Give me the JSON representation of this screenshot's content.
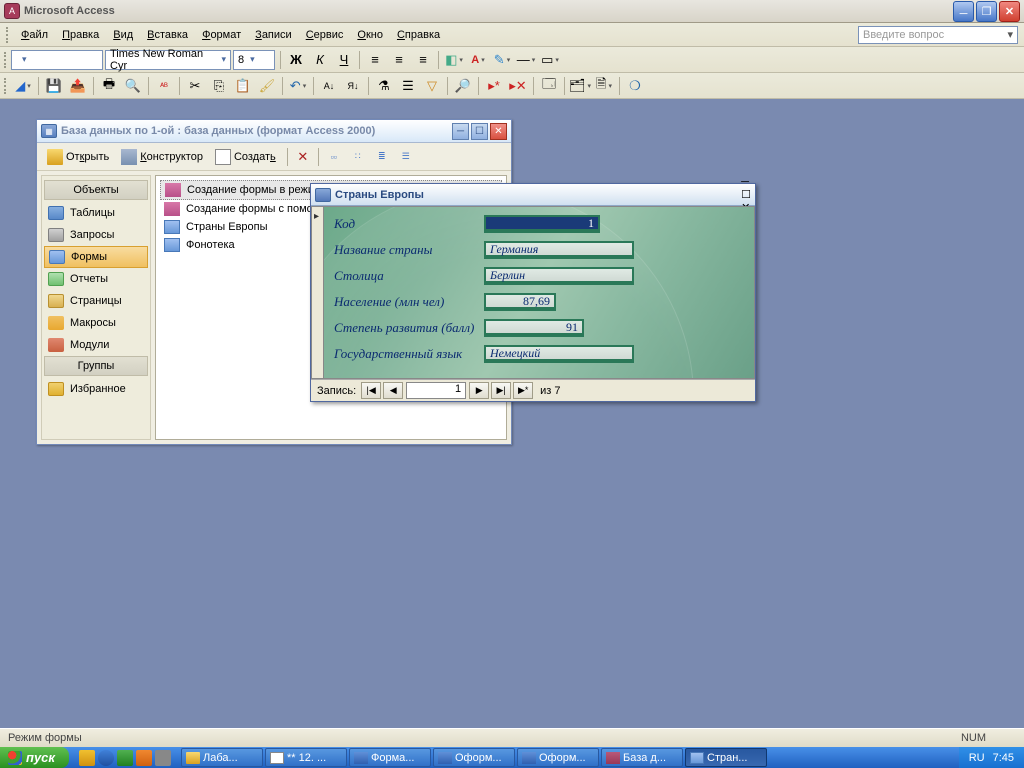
{
  "app": {
    "title": "Microsoft Access"
  },
  "menu": {
    "items": [
      "Файл",
      "Правка",
      "Вид",
      "Вставка",
      "Формат",
      "Записи",
      "Сервис",
      "Окно",
      "Справка"
    ],
    "underlines": [
      "Ф",
      "П",
      "В",
      "В",
      "Ф",
      "З",
      "С",
      "О",
      "С"
    ],
    "question_placeholder": "Введите вопрос"
  },
  "format_toolbar": {
    "font": "Times New Roman Cyr",
    "size": "8"
  },
  "dbwin": {
    "title": "База данных по 1-ой : база данных (формат Access 2000)",
    "toolbar": {
      "open": "Открыть",
      "design": "Конструктор",
      "create": "Создать"
    },
    "sidebar": {
      "header1": "Объекты",
      "items": [
        "Таблицы",
        "Запросы",
        "Формы",
        "Отчеты",
        "Страницы",
        "Макросы",
        "Модули"
      ],
      "header2": "Группы",
      "fav": "Избранное"
    },
    "list": {
      "items": [
        "Создание формы в режиме конструктора",
        "Создание формы с помощью мастера",
        "Страны Европы",
        "Фонотека"
      ]
    }
  },
  "formwin": {
    "title": "Страны Европы",
    "fields": {
      "f1": {
        "label": "Код",
        "value": "1"
      },
      "f2": {
        "label": "Название страны",
        "value": "Германия"
      },
      "f3": {
        "label": "Столица",
        "value": "Берлин"
      },
      "f4": {
        "label": "Население (млн чел)",
        "value": "87,69"
      },
      "f5": {
        "label": "Степень развития (балл)",
        "value": "91"
      },
      "f6": {
        "label": "Государственный язык",
        "value": "Немецкий"
      }
    },
    "recnav": {
      "label": "Запись:",
      "current": "1",
      "total": "из  7"
    }
  },
  "statusbar": {
    "left": "Режим формы",
    "num": "NUM"
  },
  "taskbar": {
    "start": "пуск",
    "tasks": [
      "Лаба...",
      "** 12. ...",
      "Форма...",
      "Оформ...",
      "Оформ...",
      "База д...",
      "Стран..."
    ],
    "lang": "RU",
    "time": "7:45"
  }
}
